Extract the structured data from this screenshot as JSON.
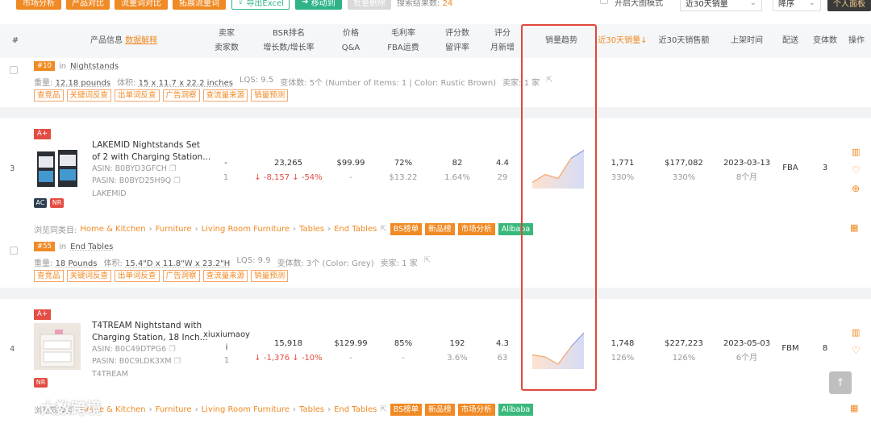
{
  "toolbar": {
    "btn_market": "市场分析",
    "btn_compare": "产品对比",
    "btn_traffic_compare": "流量词对比",
    "btn_expand_traffic": "拓展流量词",
    "btn_export": "导出Excel",
    "btn_move": "移动到",
    "btn_batch_delete": "批量删除",
    "result_label": "搜索结果数:",
    "result_count": "24",
    "toggle_big_image": "开启大图模式",
    "sort_period": "近30天销量",
    "sort_order": "降序",
    "profile_btn": "个人面板"
  },
  "table_header": {
    "col_index": "#",
    "col_product": "产品信息",
    "col_product_link": "数据解释",
    "col_seller_1": "卖家",
    "col_seller_2": "卖家数",
    "col_bsr_1": "BSR排名",
    "col_bsr_2": "增长数/增长率",
    "col_price_1": "价格",
    "col_price_2": "Q&A",
    "col_margin_1": "毛利率",
    "col_margin_2": "FBA运费",
    "col_rating_1": "评分数",
    "col_rating_2": "留评率",
    "col_score_1": "评分",
    "col_score_2": "月新增",
    "col_trend": "销量趋势",
    "col_sales30": "近30天销量↓",
    "col_revenue30": "近30天销售额",
    "col_launch": "上架时间",
    "col_fulfillment": "配送",
    "col_variants": "变体数",
    "col_actions": "操作"
  },
  "row_prev": {
    "rank_badge": "#10",
    "in_label": "in",
    "category": "Nightstands",
    "weight_label": "重量:",
    "weight": "12.18 pounds",
    "volume_label": "体积:",
    "volume": "15 x 11.7 x 22.2 inches",
    "lqs": "LQS: 9.5",
    "variants_text": "变体数: 5个 (Number of Items: 1 | Color: Rustic Brown)",
    "seller_text": "卖家: 1 家",
    "tags": [
      "查竞品",
      "关键词反查",
      "出单词反查",
      "广告洞察",
      "查流量来源",
      "销量预测"
    ]
  },
  "rows": [
    {
      "index": "3",
      "badge_top": "A+",
      "badges_bottom": [
        "AC",
        "NR"
      ],
      "title_line1": "LAKEMID Nightstands Set",
      "title_line2": "of 2 with Charging Station...",
      "asin": "ASIN: B0BYD3GFCH",
      "pasin": "PASIN: B0BYD25H9Q",
      "brand": "LAKEMID",
      "seller": "-",
      "seller_count": "1",
      "bsr": "23,265",
      "bsr_change": "↓ -8,157",
      "bsr_rate": "↓ -54%",
      "price": "$99.99",
      "qa": "-",
      "margin": "72%",
      "fba_fee": "$13.22",
      "rating_count": "82",
      "review_rate": "1.64%",
      "score": "4.4",
      "monthly_new": "29",
      "sales30": "1,771",
      "sales_pct": "330%",
      "revenue30": "$177,082",
      "revenue_pct": "330%",
      "launch_date": "2023-03-13",
      "launch_age": "8个月",
      "fulfillment": "FBA",
      "variants": "3",
      "breadcrumb_label": "浏览同类目:",
      "breadcrumb": [
        "Home & Kitchen",
        "Furniture",
        "Living Room Furniture",
        "Tables",
        "End Tables"
      ],
      "btags": [
        "BS榜单",
        "新品榜",
        "市场分析",
        "Alibaba"
      ],
      "sub_rank": "#55",
      "sub_in": "in",
      "sub_category": "End Tables",
      "weight_label": "重量:",
      "weight": "18 Pounds",
      "volume_label": "体积:",
      "volume": "15.4\"D x 11.8\"W x 23.2\"H",
      "lqs": "LQS: 9.9",
      "variants_text": "变体数: 3个 (Color: Grey)",
      "seller_text": "卖家: 1 家",
      "tags": [
        "查竞品",
        "关键词反查",
        "出单词反查",
        "广告洞察",
        "查流量来源",
        "销量预测"
      ],
      "trend": [
        0.15,
        0.35,
        0.25,
        0.75,
        0.95
      ]
    },
    {
      "index": "4",
      "badge_top": "A+",
      "badges_bottom": [
        "NR"
      ],
      "title_line1": "T4TREAM Nightstand with",
      "title_line2": "Charging Station, 18 Inch...",
      "asin": "ASIN: B0C49DTPG6",
      "pasin": "PASIN: B0C9LDK3XM",
      "brand": "T4TREAM",
      "seller": "xiuxiumaoyi",
      "seller_count": "1",
      "bsr": "15,918",
      "bsr_change": "↓ -1,376",
      "bsr_rate": "↓ -10%",
      "price": "$129.99",
      "qa": "-",
      "margin": "85%",
      "fba_fee": "-",
      "rating_count": "192",
      "review_rate": "3.6%",
      "score": "4.3",
      "monthly_new": "63",
      "sales30": "1,748",
      "sales_pct": "126%",
      "revenue30": "$227,223",
      "revenue_pct": "126%",
      "launch_date": "2023-05-03",
      "launch_age": "6个月",
      "fulfillment": "FBM",
      "variants": "8",
      "breadcrumb_label": "浏览同类目:",
      "breadcrumb": [
        "Home & Kitchen",
        "Furniture",
        "Living Room Furniture",
        "Tables",
        "End Tables"
      ],
      "btags": [
        "BS榜单",
        "新品榜",
        "市场分析",
        "Alibaba"
      ],
      "trend": [
        0.35,
        0.3,
        0.12,
        0.55,
        0.9
      ]
    }
  ],
  "watermark": "大数跨境",
  "colors": {
    "orange": "#f08a24",
    "green": "#2fb389",
    "red": "#e34d43",
    "highlight_box": "#e0463b"
  }
}
